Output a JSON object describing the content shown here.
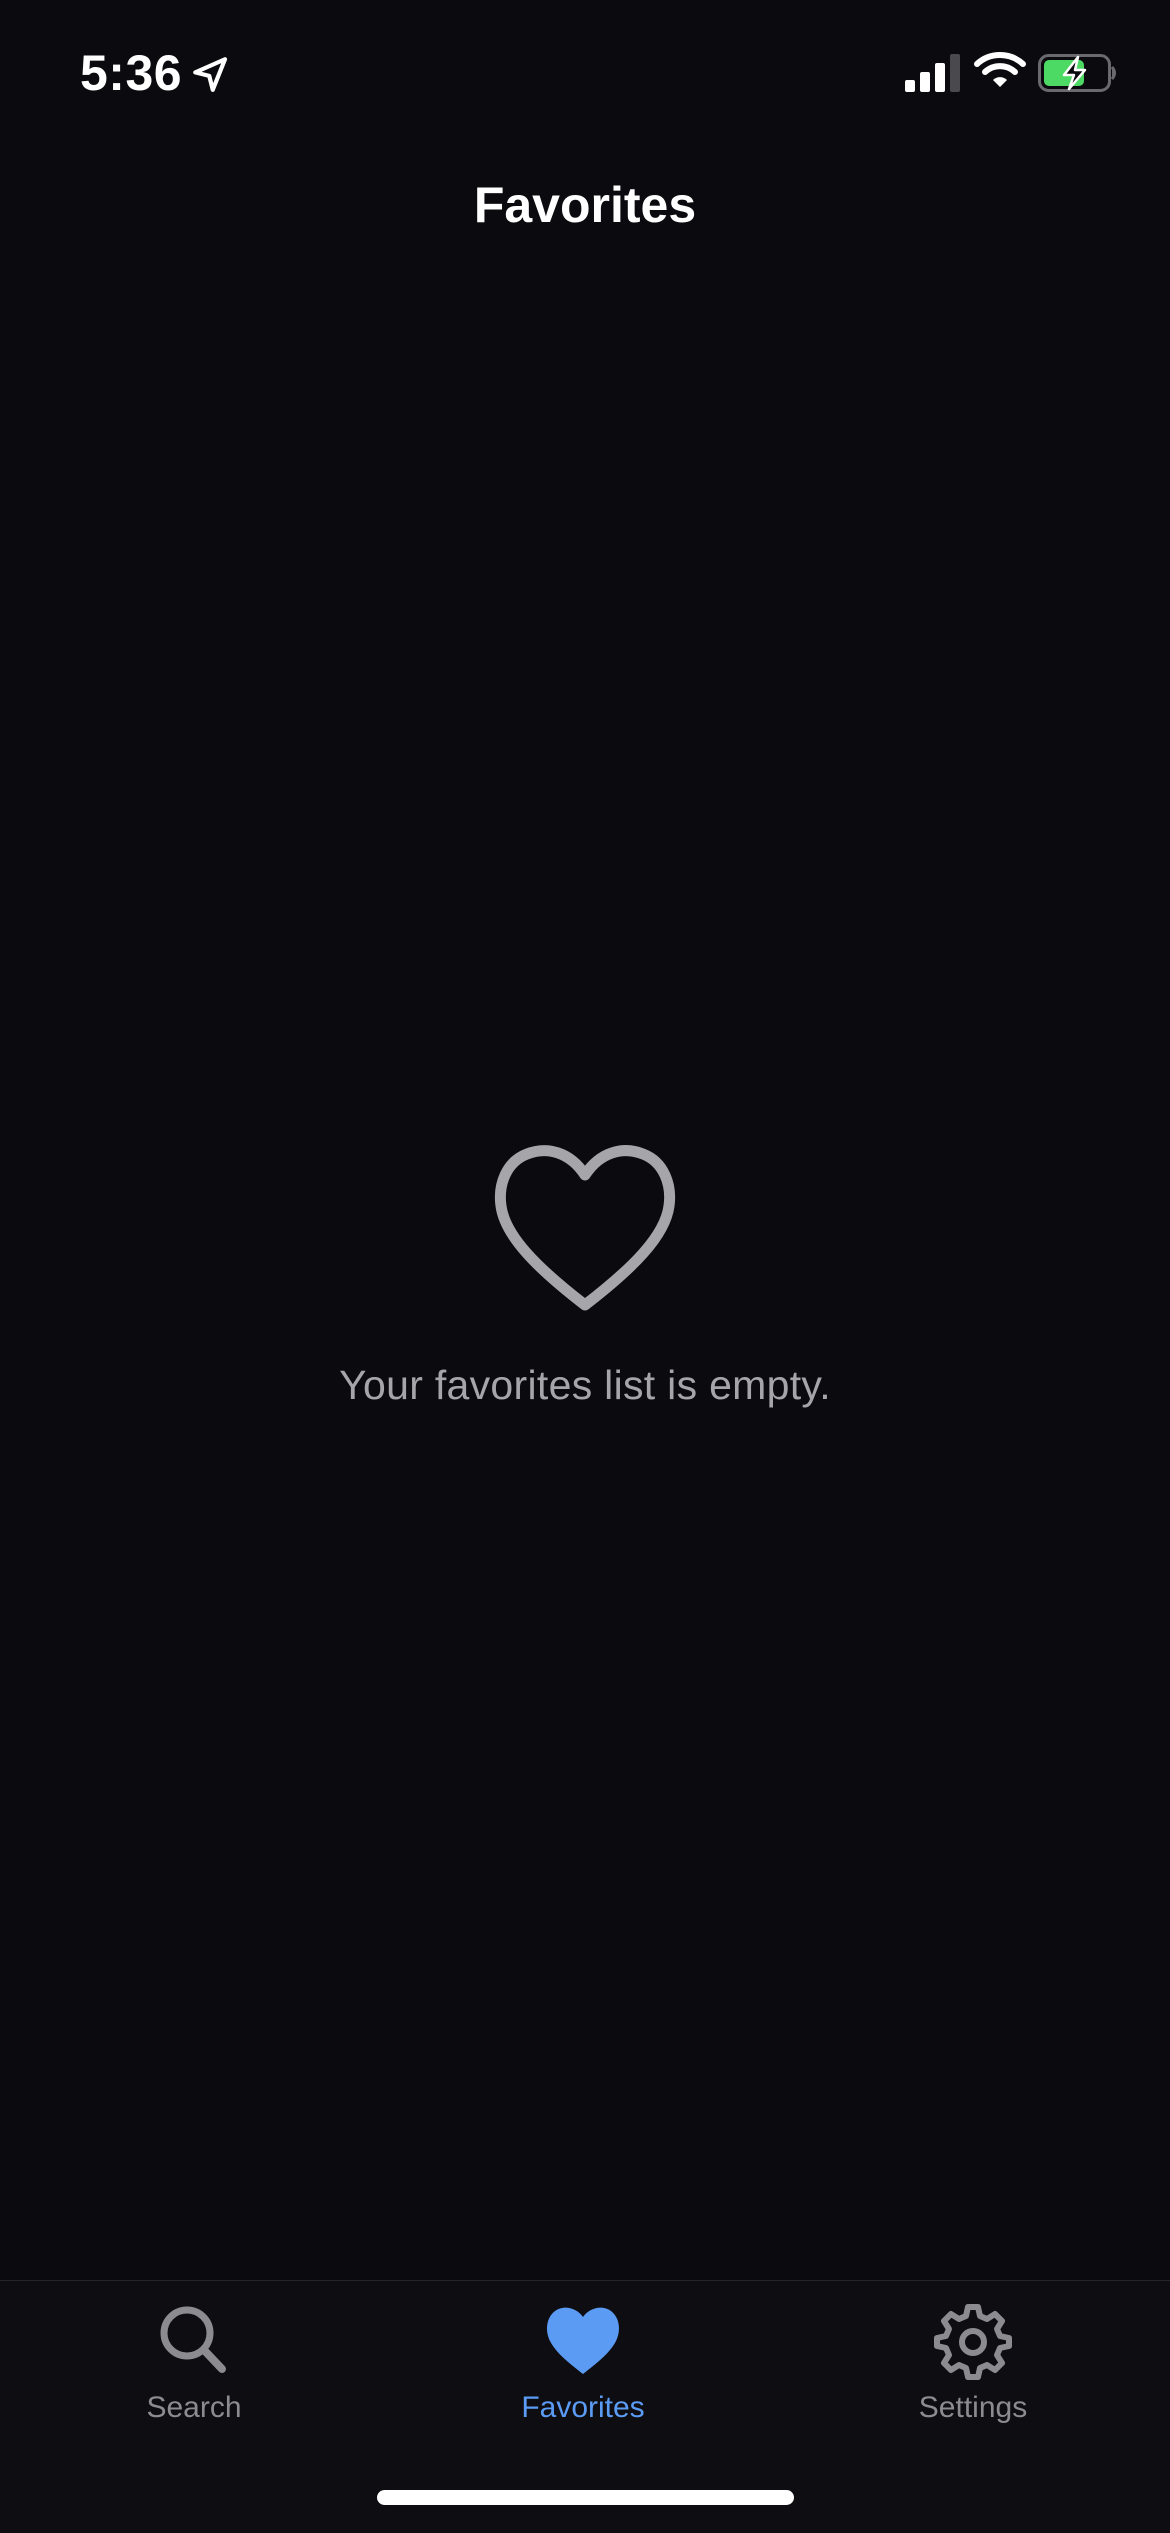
{
  "status_bar": {
    "time": "5:36",
    "location_icon": "location-arrow-icon",
    "signal_icon": "cellular-signal-icon",
    "wifi_icon": "wifi-icon",
    "battery_icon": "battery-charging-icon",
    "battery_color": "#4cd964"
  },
  "header": {
    "title": "Favorites"
  },
  "empty_state": {
    "icon": "heart-outline-icon",
    "message": "Your favorites list is empty.",
    "icon_color": "#a6a5aa"
  },
  "tab_bar": {
    "tabs": [
      {
        "label": "Search",
        "icon": "magnifying-glass-icon",
        "selected": false
      },
      {
        "label": "Favorites",
        "icon": "heart-icon",
        "selected": true
      },
      {
        "label": "Settings",
        "icon": "gear-icon",
        "selected": false
      }
    ],
    "active_color": "#5b9bf4",
    "inactive_color": "#8c8b90"
  }
}
